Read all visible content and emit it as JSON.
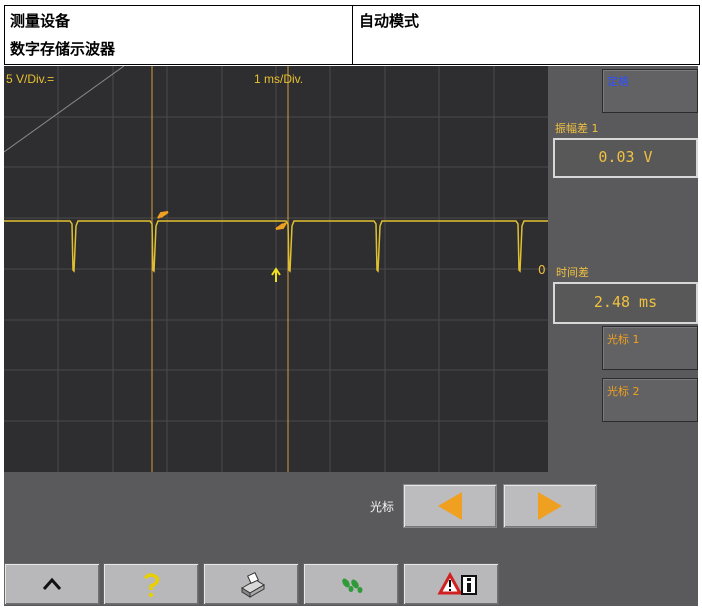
{
  "header": {
    "title_line1": "测量设备",
    "title_line2": "数字存储示波器",
    "mode": "自动模式"
  },
  "scope": {
    "vdiv": "5 V/Div.=",
    "tdiv": "1 ms/Div.",
    "zero_marker": "0"
  },
  "side_panel": {
    "top_button": "定格",
    "amplitude_label": "振幅差 1",
    "amplitude_value": "0.03 V",
    "time_label": "时间差",
    "time_value": "2.48 ms",
    "cursor1": "光标 1",
    "cursor2": "光标 2"
  },
  "cursor_nav": {
    "label": "光标"
  },
  "toolbar": {
    "buttons": [
      "chevron-up-icon",
      "help-icon",
      "print-icon",
      "footprints-icon",
      "warning-info-icon"
    ]
  },
  "colors": {
    "signal": "#e0c030",
    "cursor_line": "#d4a040",
    "accent_orange": "#f0a020",
    "label_yellow": "#f0c040"
  }
}
